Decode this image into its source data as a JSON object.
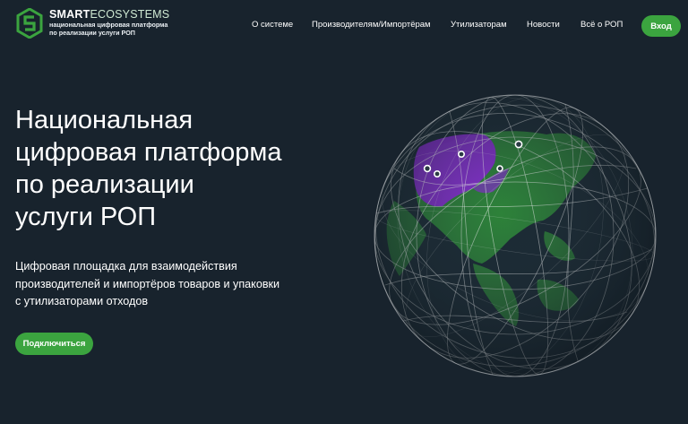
{
  "header": {
    "logo": {
      "name_bold": "SMART",
      "name_light": "ECOSYSTEMS",
      "tagline_line1": "национальная цифровая платформа",
      "tagline_line2": "по реализации услуги РОП"
    },
    "nav": [
      {
        "label": "О системе"
      },
      {
        "label": "Производителям/Импортёрам"
      },
      {
        "label": "Утилизаторам"
      },
      {
        "label": "Новости"
      },
      {
        "label": "Всё о РОП"
      }
    ],
    "login_label": "Вход"
  },
  "hero": {
    "title_lines": [
      "Национальная",
      "цифровая платформа",
      "по реализации",
      "услуги РОП"
    ],
    "subtitle_lines": [
      "Цифровая площадка для взаимодействия",
      "производителей и импортёров товаров и упаковки",
      "с утилизаторами отходов"
    ],
    "cta_label": "Подключиться"
  },
  "colors": {
    "background": "#18232d",
    "accent_green": "#3ba43f",
    "land_green": "#2f8a3a",
    "highlight_purple": "#8a2bd6"
  },
  "icons": {
    "logo": "smart-ecosystems-logo-icon",
    "globe": "globe-network-illustration"
  }
}
